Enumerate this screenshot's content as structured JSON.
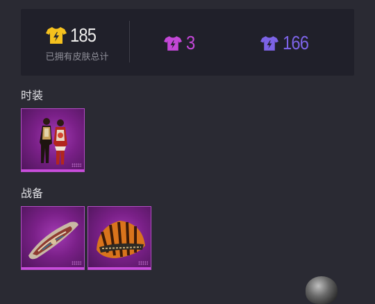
{
  "stats": {
    "total_count": "185",
    "total_label": "已拥有皮肤总计",
    "pink_count": "3",
    "purple_count": "166",
    "colors": {
      "gold": "#f5c11e",
      "pink": "#c347d7",
      "purple": "#7c63e6"
    }
  },
  "sections": {
    "fashion_title": "时装",
    "gear_title": "战备"
  },
  "icons": {
    "shirt": "tshirt-lightning-icon"
  }
}
